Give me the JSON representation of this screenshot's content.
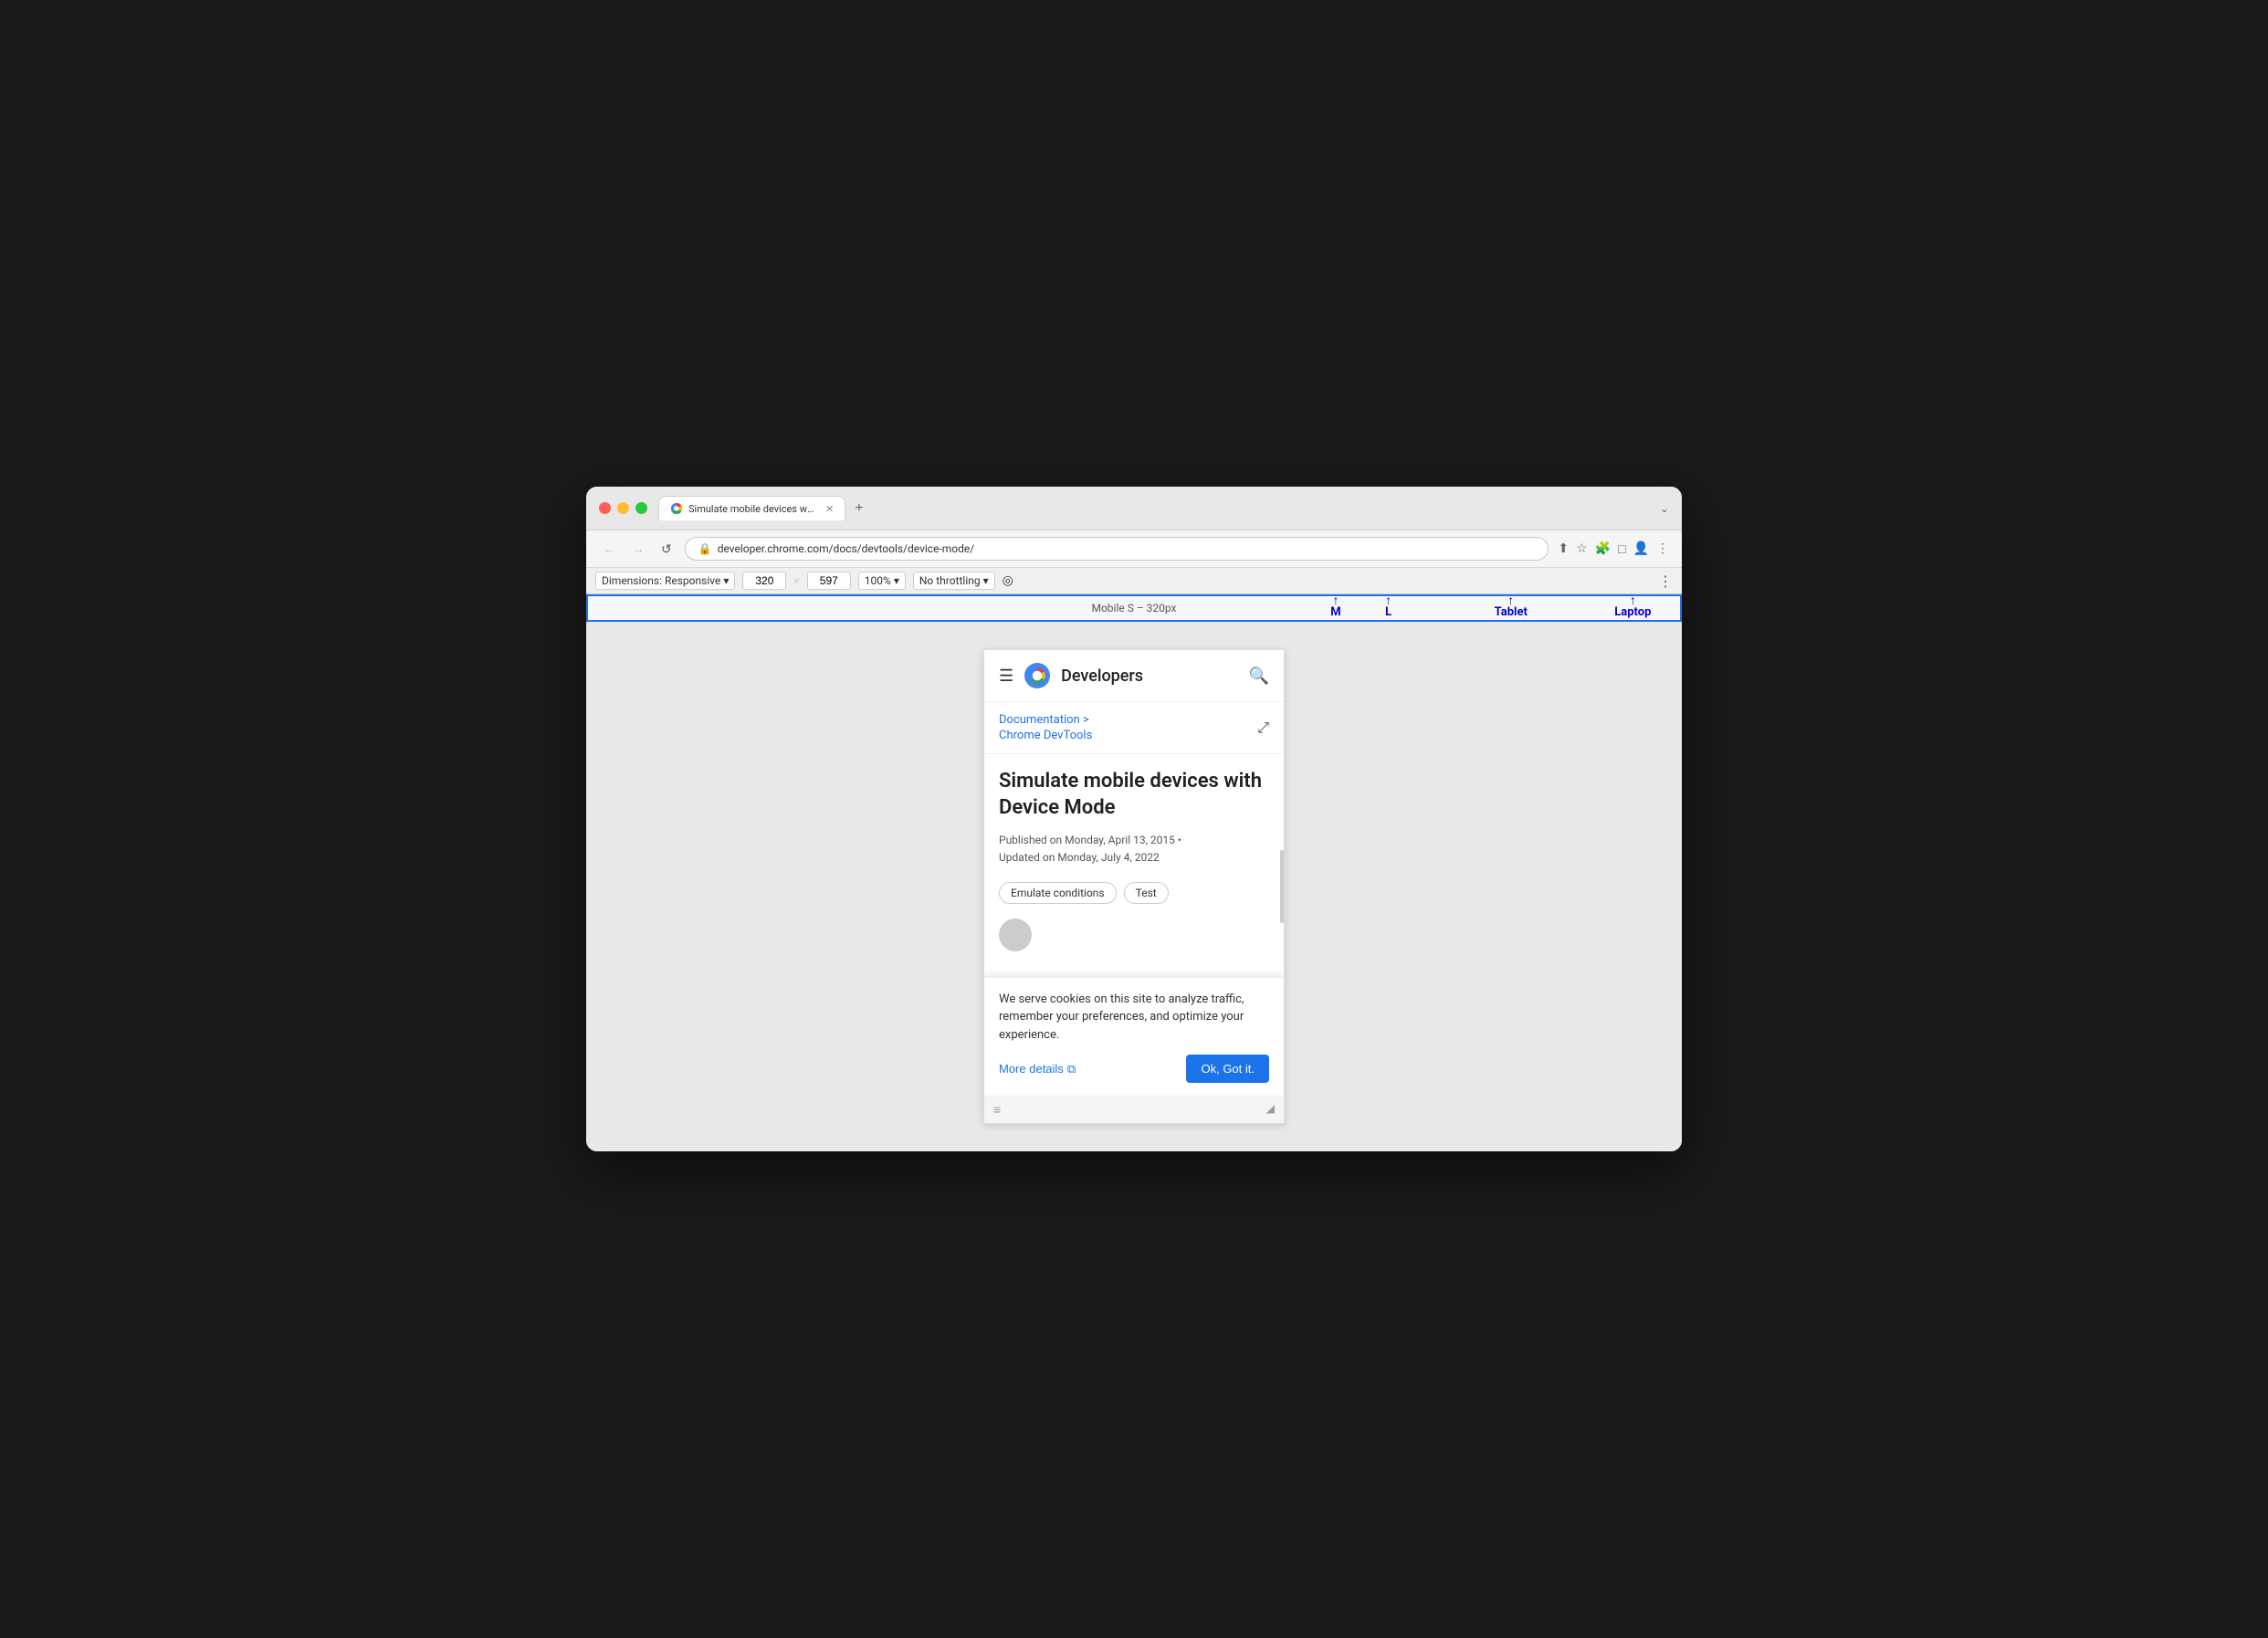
{
  "window": {
    "title": "Simulate mobile devices with Device Mode"
  },
  "titleBar": {
    "trafficLights": [
      "red",
      "yellow",
      "green"
    ],
    "tab": {
      "label": "Simulate mobile devices with D",
      "favicon": "chrome"
    },
    "newTabLabel": "+",
    "moreTabsLabel": "⌄"
  },
  "addressBar": {
    "back": "←",
    "forward": "→",
    "reload": "↺",
    "url": "developer.chrome.com/docs/devtools/device-mode/",
    "icons": [
      "share",
      "star",
      "puzzle",
      "person-circle",
      "extension",
      "profile",
      "more"
    ]
  },
  "devToolsBar": {
    "dimensions_label": "Dimensions: Responsive",
    "width": "320",
    "cross": "×",
    "height": "597",
    "zoom": "100%",
    "throttle": "No throttling",
    "more": "⋮"
  },
  "responsiveBar": {
    "label": "Mobile S – 320px",
    "breakpoints": [
      {
        "label": "M",
        "position": 68
      },
      {
        "label": "L",
        "position": 73
      },
      {
        "label": "Tablet",
        "position": 84
      },
      {
        "label": "Laptop",
        "position": 96
      }
    ]
  },
  "site": {
    "header": {
      "hamburger": "☰",
      "title": "Developers",
      "searchIcon": "🔍"
    },
    "breadcrumb": {
      "items": [
        "Documentation  >",
        "Chrome DevTools"
      ],
      "shareIcon": "⤢"
    },
    "article": {
      "title": "Simulate mobile devices with Device Mode",
      "publishedDate": "Published on Monday, April 13, 2015 •",
      "updatedDate": "Updated on Monday, July 4, 2022",
      "tags": [
        "Emulate conditions",
        "Test"
      ]
    },
    "cookieBanner": {
      "text": "We serve cookies on this site to analyze traffic, remember your preferences, and optimize your experience.",
      "moreDetailsLabel": "More details",
      "moreDetailsIcon": "⧉",
      "okLabel": "Ok, Got it."
    }
  },
  "colors": {
    "accent": "#1a73e8",
    "blue_label": "#0000cc",
    "chrome_blue": "#4285f4"
  }
}
